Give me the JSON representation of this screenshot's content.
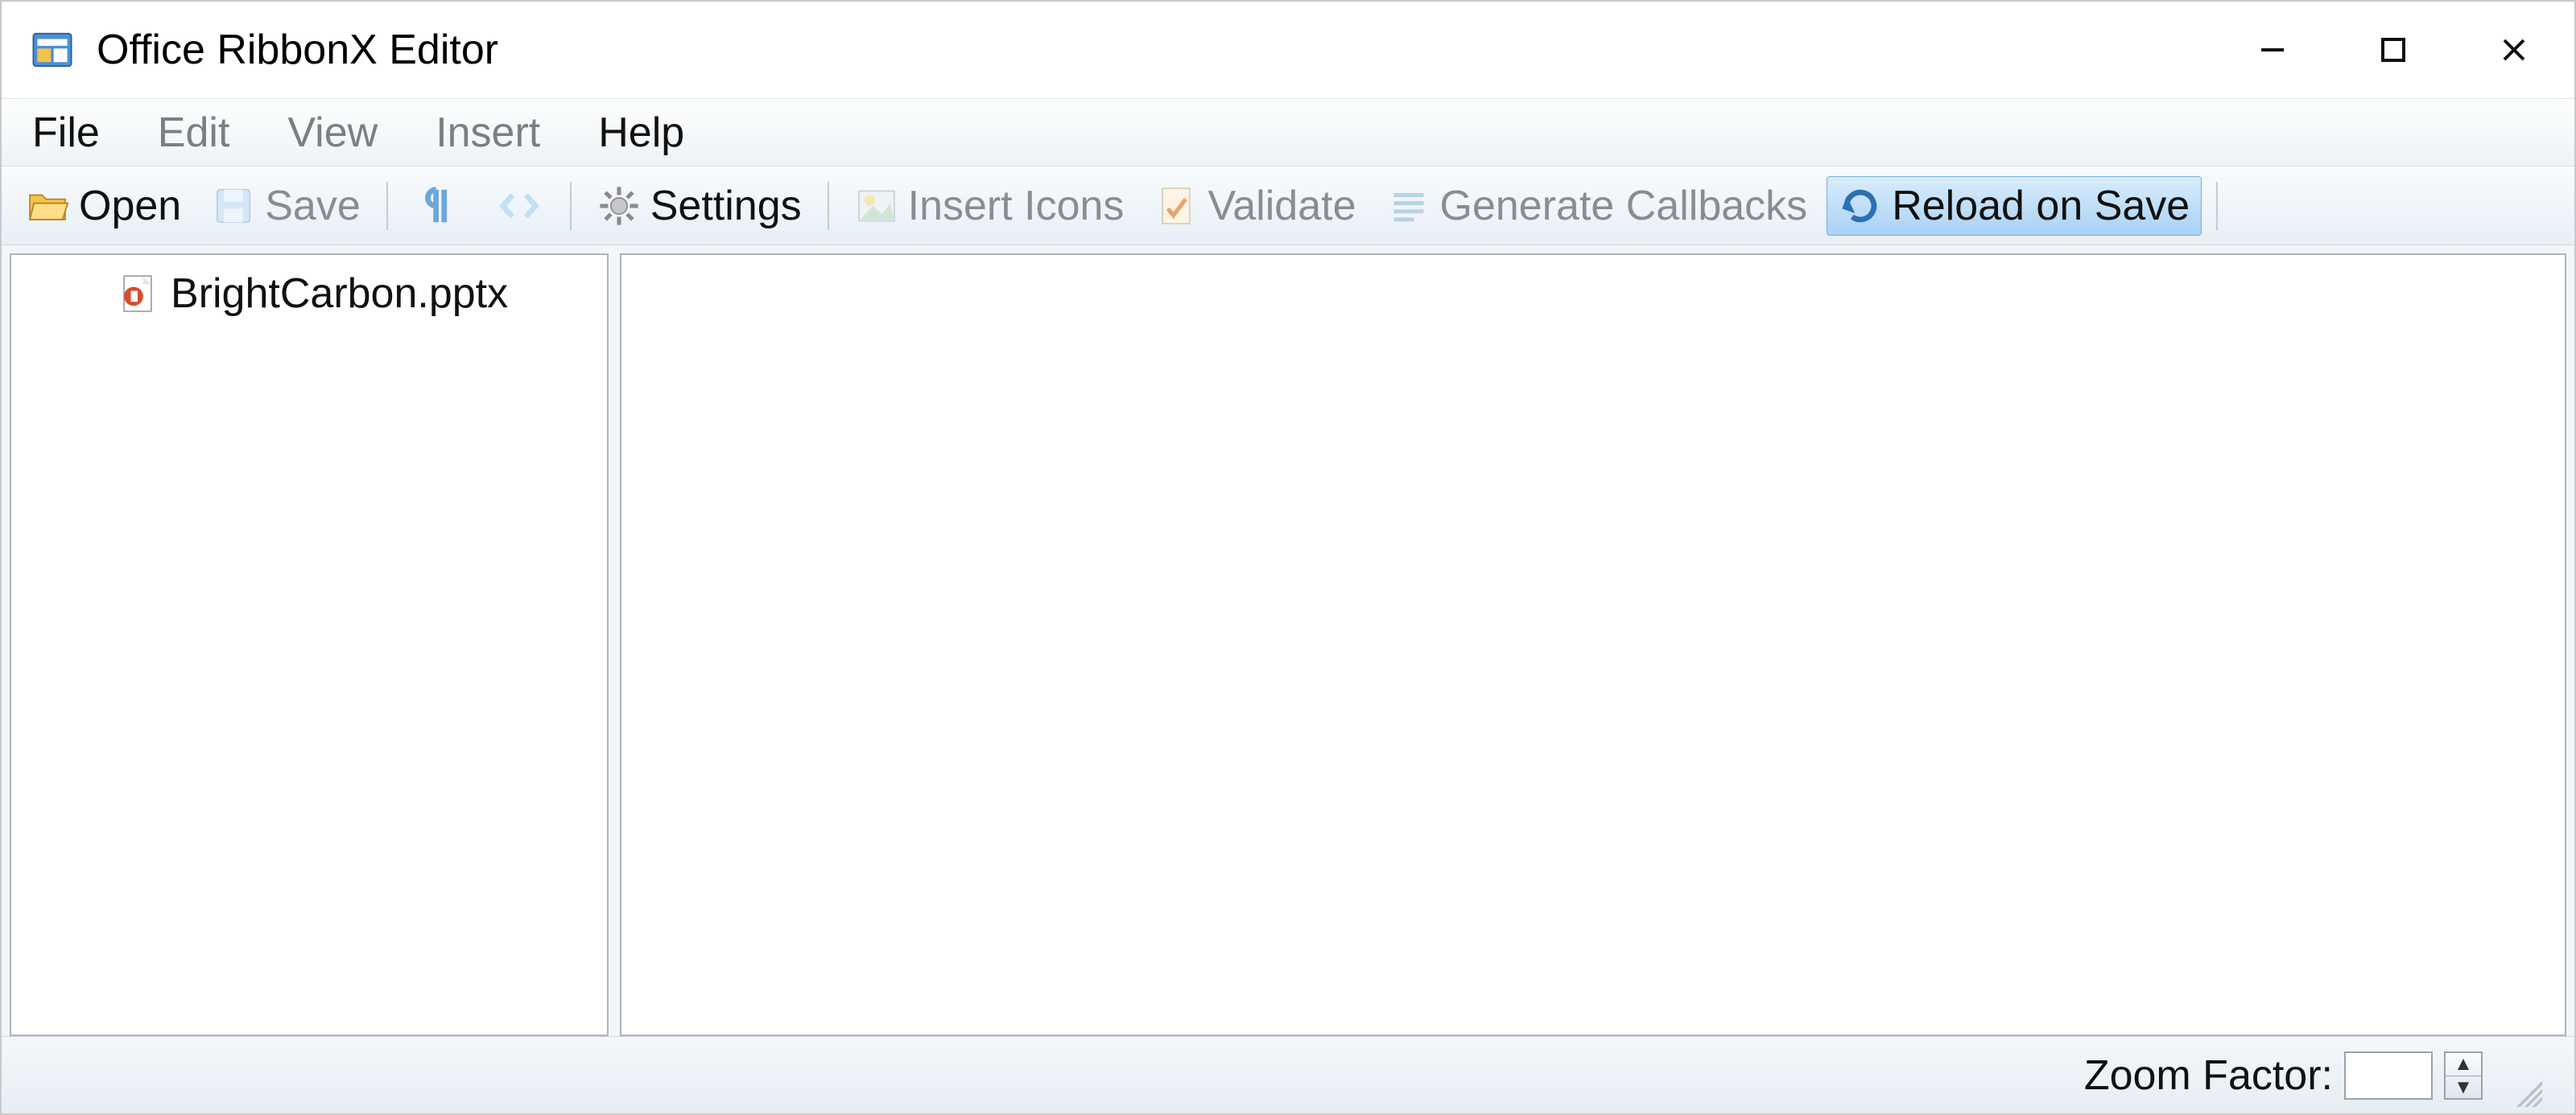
{
  "window": {
    "title": "Office RibbonX Editor"
  },
  "menu": {
    "file": "File",
    "edit": "Edit",
    "view": "View",
    "insert": "Insert",
    "help": "Help"
  },
  "toolbar": {
    "open": "Open",
    "save": "Save",
    "settings": "Settings",
    "insert_icons": "Insert Icons",
    "validate": "Validate",
    "generate_callbacks": "Generate Callbacks",
    "reload_on_save": "Reload on Save"
  },
  "tree": {
    "items": [
      {
        "label": "BrightCarbon.pptx"
      }
    ]
  },
  "status": {
    "zoom_label": "Zoom Factor:",
    "zoom_value": ""
  }
}
